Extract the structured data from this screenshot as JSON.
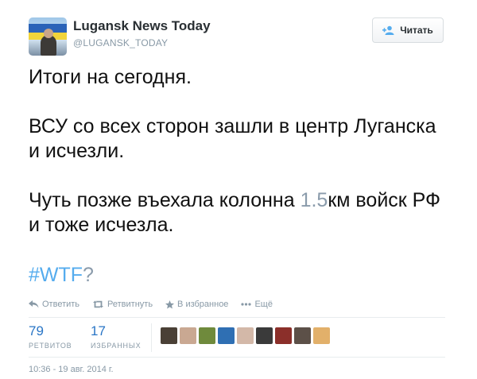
{
  "author": {
    "name": "Lugansk News Today",
    "handle": "@LUGANSK_TODAY"
  },
  "follow_button": {
    "label": "Читать",
    "icon": "follow-person-plus-icon"
  },
  "tweet": {
    "p1": "Итоги на сегодня.",
    "p2_line1": "ВСУ со всех сторон зашли в центр Луганска",
    "p2_line2": "и исчезли.",
    "p3_line1_pre": "Чуть позже въехала колонна ",
    "p3_line1_num": "1.5",
    "p3_line1_post": "км войск РФ",
    "p3_line2": "и тоже исчезла.",
    "hashtag": "#WTF",
    "hashtag_suffix": "?"
  },
  "actions": [
    {
      "label": "Ответить",
      "icon": "reply-icon"
    },
    {
      "label": "Ретвитнуть",
      "icon": "retweet-icon"
    },
    {
      "label": "В избранное",
      "icon": "star-icon"
    },
    {
      "label": "Ещё",
      "icon": "more-dots-icon"
    }
  ],
  "stats": {
    "retweets": {
      "count": "79",
      "label": "РЕТВИТОВ"
    },
    "favorites": {
      "count": "17",
      "label": "ИЗБРАННЫХ"
    }
  },
  "favoriter_avatars": [
    {
      "color": "#4a4036"
    },
    {
      "color": "#c9a892"
    },
    {
      "color": "#6f8a3c"
    },
    {
      "color": "#2f6fb3"
    },
    {
      "color": "#d3b8a8"
    },
    {
      "color": "#3a3a3a"
    },
    {
      "color": "#8b2f2a"
    },
    {
      "color": "#5c5048"
    },
    {
      "color": "#e2b06a"
    }
  ],
  "timestamp": "10:36 - 19 авг. 2014 г.",
  "colors": {
    "link": "#55acee",
    "stat_count": "#2a76c6",
    "muted": "#8899a6"
  }
}
